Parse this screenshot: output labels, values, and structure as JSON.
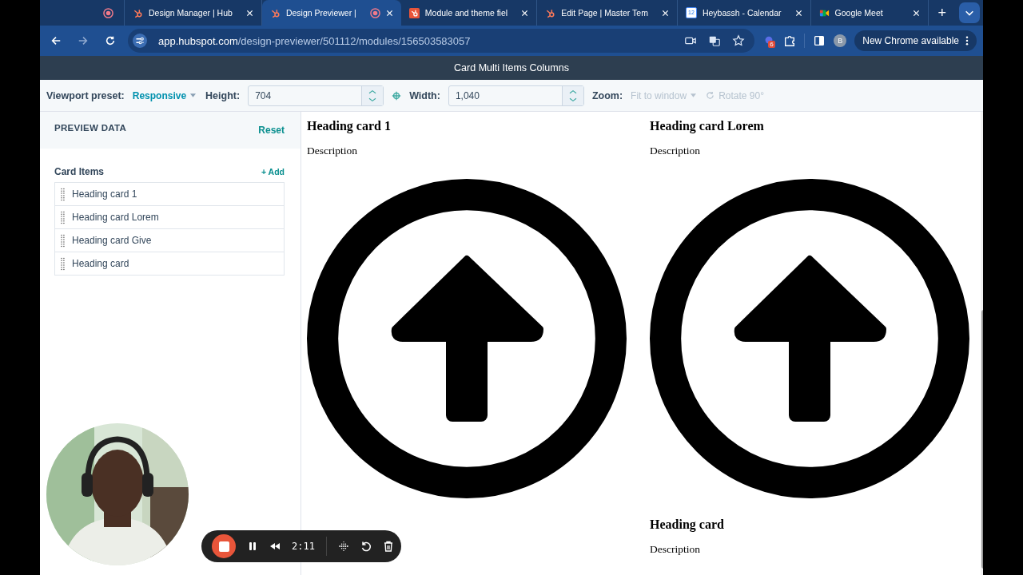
{
  "browser": {
    "tabs": [
      {
        "kind": "pinned",
        "selected": false
      },
      {
        "kind": "hubspot",
        "title": "Design Manager | Hub",
        "selected": false
      },
      {
        "kind": "hubspot",
        "title": "Design Previewer |",
        "selected": true,
        "recording": true
      },
      {
        "kind": "box",
        "title": "Module and theme fiel",
        "selected": false
      },
      {
        "kind": "hubspot",
        "title": "Edit Page | Master Tem",
        "selected": false
      },
      {
        "kind": "calendar",
        "title": "Heybassh - Calendar",
        "selected": false,
        "icon_text": "12"
      },
      {
        "kind": "meet",
        "title": "Google Meet",
        "selected": false
      }
    ],
    "new_tab": "+",
    "address": {
      "host": "app.hubspot.com",
      "path": "/design-previewer/501112/modules/156503583057"
    },
    "extension_badge": "6",
    "avatar": "B",
    "update_button": "New Chrome available"
  },
  "app": {
    "title": "Card Multi Items Columns",
    "toolbar": {
      "viewport_label": "Viewport preset:",
      "viewport_value": "Responsive",
      "height_label": "Height:",
      "height_value": "704",
      "width_label": "Width:",
      "width_value": "1,040",
      "zoom_label": "Zoom:",
      "zoom_value": "Fit to window",
      "zoom_disabled": true,
      "rotate": "Rotate 90°",
      "rotate_disabled": true
    },
    "sidebar": {
      "title": "PREVIEW DATA",
      "reset": "Reset",
      "section": "Card Items",
      "add": "+ Add",
      "items": [
        "Heading card 1",
        "Heading card Lorem",
        "Heading card Give",
        "Heading card"
      ]
    },
    "columns": [
      {
        "cards": [
          {
            "heading": "Heading card 1",
            "description": "Description"
          }
        ]
      },
      {
        "cards": [
          {
            "heading": "Heading card Lorem",
            "description": "Description"
          },
          {
            "heading": "Heading card",
            "description": "Description"
          }
        ]
      }
    ]
  },
  "recorder": {
    "time": "2:11"
  }
}
